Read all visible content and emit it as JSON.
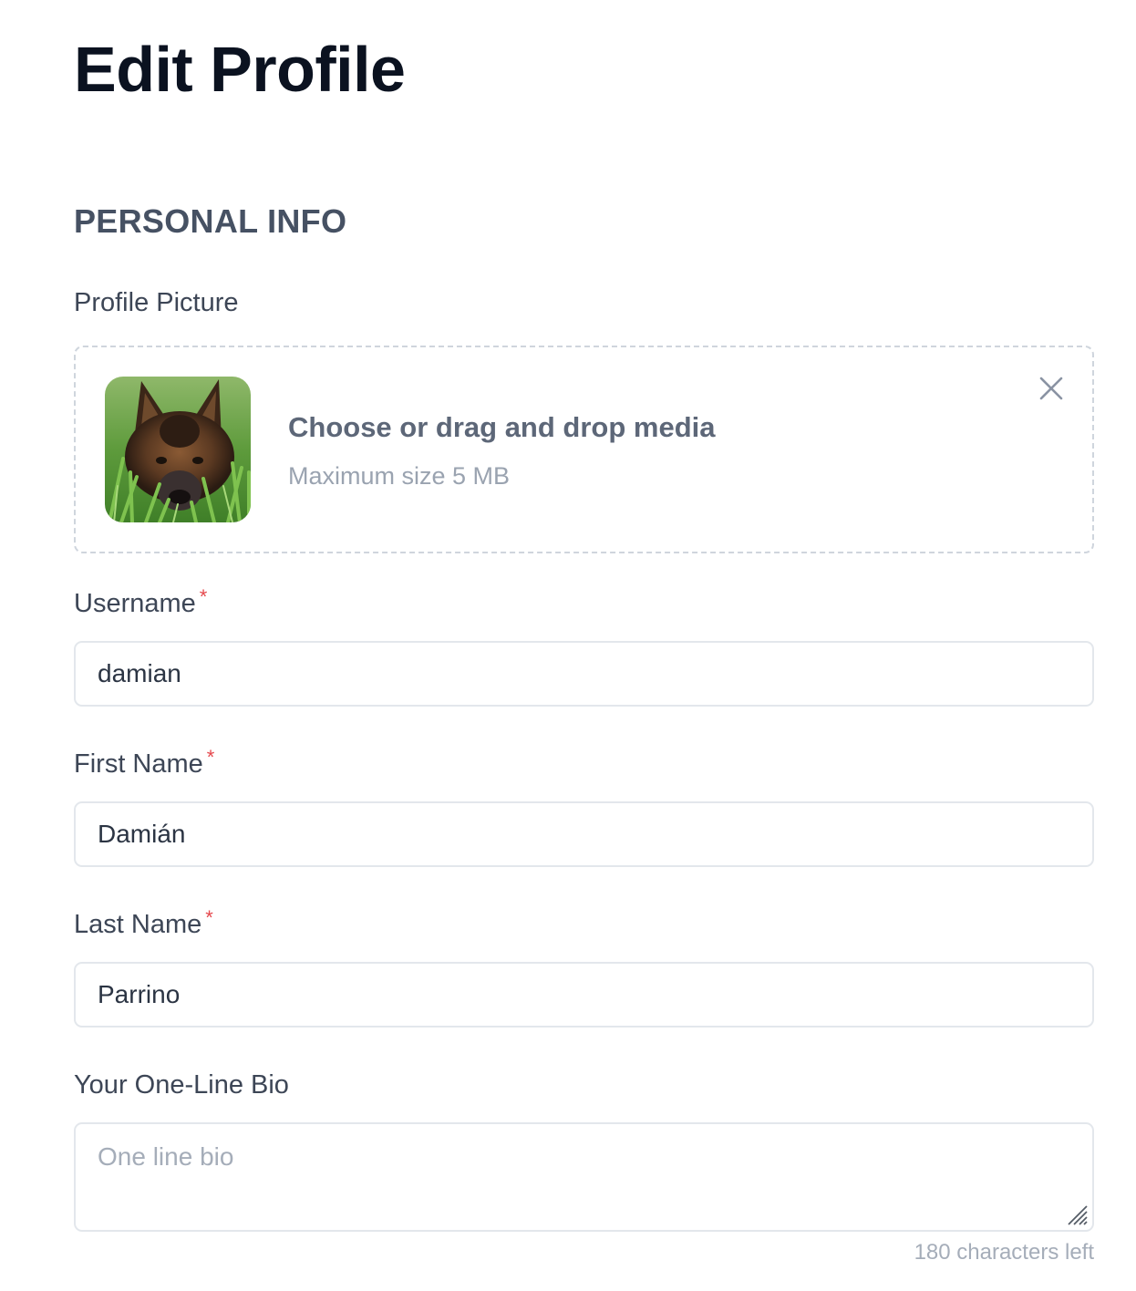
{
  "page": {
    "title": "Edit Profile"
  },
  "personal_info": {
    "section_title": "PERSONAL INFO",
    "profile_picture": {
      "label": "Profile Picture",
      "dropzone_title": "Choose or drag and drop media",
      "dropzone_subtitle": "Maximum size 5 MB",
      "avatar_icon": "dog-photo",
      "close_icon": "close-icon"
    },
    "username": {
      "label": "Username",
      "required_mark": "*",
      "value": "damian"
    },
    "first_name": {
      "label": "First Name",
      "required_mark": "*",
      "value": "Damián"
    },
    "last_name": {
      "label": "Last Name",
      "required_mark": "*",
      "value": "Parrino"
    },
    "bio": {
      "label": "Your One-Line Bio",
      "value": "",
      "placeholder": "One line bio",
      "counter": "180 characters left"
    }
  },
  "colors": {
    "title": "#0b1220",
    "section": "#465163",
    "required": "#e5484d",
    "border": "#e3e7ec",
    "muted": "#a5adb9"
  }
}
